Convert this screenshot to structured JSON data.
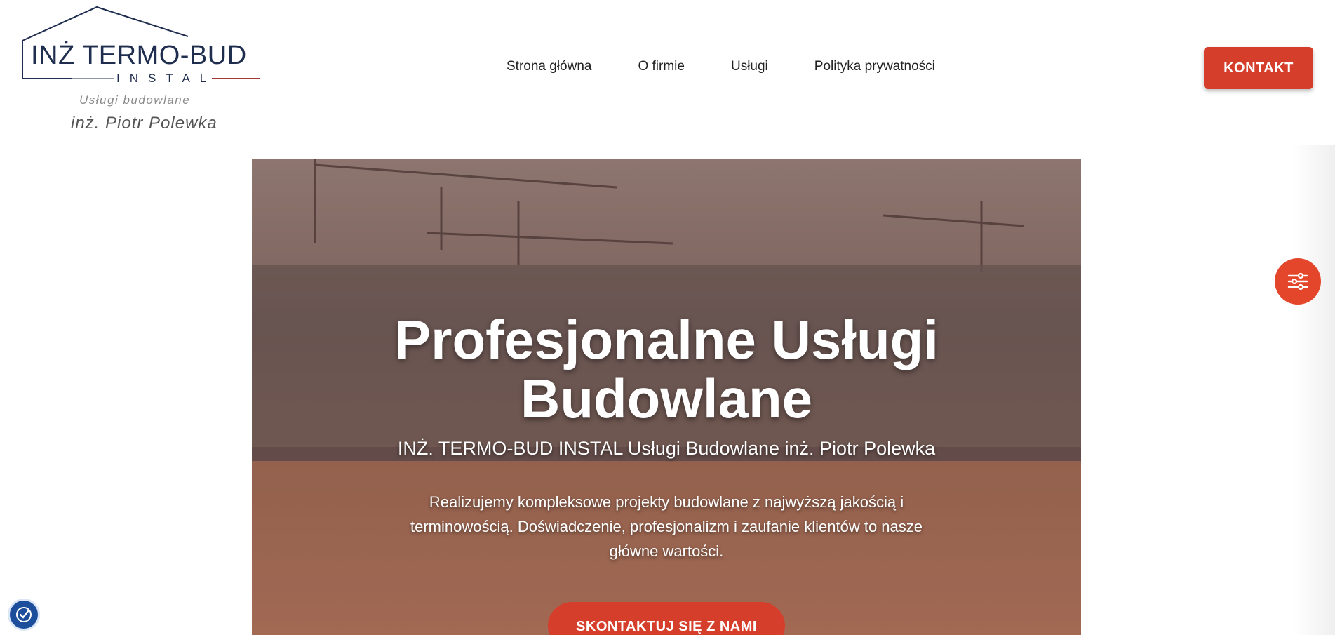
{
  "logo": {
    "main": "INŻ  TERMO-BUD",
    "instal": "INSTAL",
    "tagline": "Usługi budowlane",
    "owner": "inż. Piotr Polewka"
  },
  "nav": {
    "items": [
      {
        "label": "Strona główna"
      },
      {
        "label": "O firmie"
      },
      {
        "label": "Usługi"
      },
      {
        "label": "Polityka prywatności"
      }
    ],
    "cta_label": "KONTAKT"
  },
  "hero": {
    "title_line1": "Profesjonalne Usługi",
    "title_line2": "Budowlane",
    "subtitle": "INŻ. TERMO-BUD INSTAL Usługi Budowlane inż. Piotr Polewka",
    "desc_line1": "Realizujemy kompleksowe projekty budowlane z najwyższą jakością i",
    "desc_line2": "terminowością. Doświadczenie, profesjonalizm i zaufanie klientów to nasze",
    "desc_line3": "główne wartości.",
    "cta_label": "SKONTAKTUJ SIĘ Z NAMI"
  },
  "widgets": {
    "settings_icon": "sliders-icon",
    "accessibility_icon": "accessibility-icon"
  },
  "colors": {
    "accent": "#d63e2c",
    "brand_navy": "#1f2d4e",
    "a11y_blue": "#1c4e9c"
  }
}
